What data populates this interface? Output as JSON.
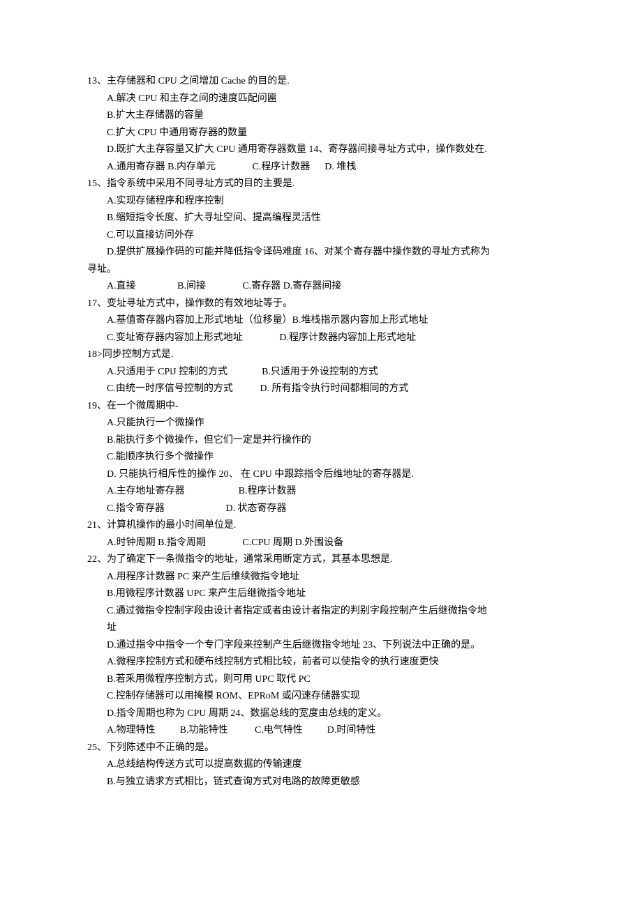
{
  "questions": [
    {
      "num": "13、",
      "stem": "主存储器和 CPU 之间增加 Cache 的目的是.",
      "options": [
        "A.解决 CPU 和主存之间的速度匹配问匾",
        "B.扩大主存储器的容量",
        "C.扩大 CPU 中通用寄存器的数量",
        "D.既扩大主存容量又扩大 CPU 通用寄存器数量 14、寄存器间接寻址方式中，操作数处在.",
        "A.通用寄存器 B.内存单元               C.程序计数器      D. 堆栈"
      ]
    },
    {
      "num": "15、",
      "stem": "指令系统中采用不同寻址方式的目的主要是.",
      "options": [
        "A.实现存储程序和程序控制",
        "B.缩短指令长度、扩大寻址空间、提高编程灵活性",
        "C.可以直接访问外存",
        "D.提供扩展操作码的可能并降低指令译码难度 16、对某个寄存器中操作数的寻址方式称为"
      ]
    },
    {
      "tail": "寻址。",
      "options": [
        "A.直接                 B.间接               C.寄存器 D.寄存器间接"
      ]
    },
    {
      "num": "17、",
      "stem": "变址寻址方式中，操作数的有效地址等于。",
      "options": [
        "A.基值寄存器内容加上形式地址（位移量）B.堆栈指示器内容加上形式地址",
        "C.变址寄存器内容加上形式地址               D.程序计数器内容加上形式地址"
      ]
    },
    {
      "num": "18>",
      "stem": "同步控制方式是.",
      "options": [
        "A.只适用于 CPiJ 控制的方式              B.只适用于外设控制的方式",
        "C.由统一时序信号控制的方式           D. 所有指令执行时间都相同的方式"
      ]
    },
    {
      "num": "19、",
      "stem": "在一个微周期中-",
      "options": [
        "A.只能执行一个微操作",
        "B.能执行多个微操作，但它们一定是并行操作的",
        "C.能顺序执行多个微操作",
        "D. 只能执行相斥性的操作 20、 在 CPU 中跟踪指令后维地址的寄存器是.",
        "A.主存地址寄存器                      B.程序计数器",
        "C.指令寄存器                         D. 状态寄存器"
      ]
    },
    {
      "num": "21、",
      "stem": "计算机操作的最小时间单位是.",
      "options": [
        "A.时钟周期 B.指令周期               C.CPU 周期 D.外围设备"
      ]
    },
    {
      "num": "22、",
      "stem": "为了确定下一条微指令的地址，通常采用断定方式，其基本思想是.",
      "options": [
        "A.用程序计数器 PC 来产生后维续微指令地址",
        "B.用微程序计数器 UPC 来产生后继微指令地址",
        "C.通过微指令控制字段由设计者指定或者由设计者指定的判别字段控制产生后继微指令地",
        "址",
        "D.通过指令中指令一个专门字段来控制产生后继微指令地址 23、下列说法中正确的是。",
        "A.微程序控制方式和硬布线控制方式相比较，前者可以使指令的执行速度更快",
        "B.若釆用微程序控制方式，则可用 UPC 取代 PC",
        "C.控制存储器可以用掩模 ROM、EPRoM 或闪速存储器实现",
        "D.指令周期也称为 CPU 周期 24、数据总线的宽度由总线的定义。",
        "A.物理特性          B.功能特性           C.电气特性          D.时间特性"
      ]
    },
    {
      "num": "25、",
      "stem": "下列陈述中不正确的是。",
      "options": [
        "A.总线结构传送方式可以提高数据的传输速度",
        "B.与独立请求方式相比，链式查询方式对电路的故障更敏感"
      ]
    }
  ]
}
